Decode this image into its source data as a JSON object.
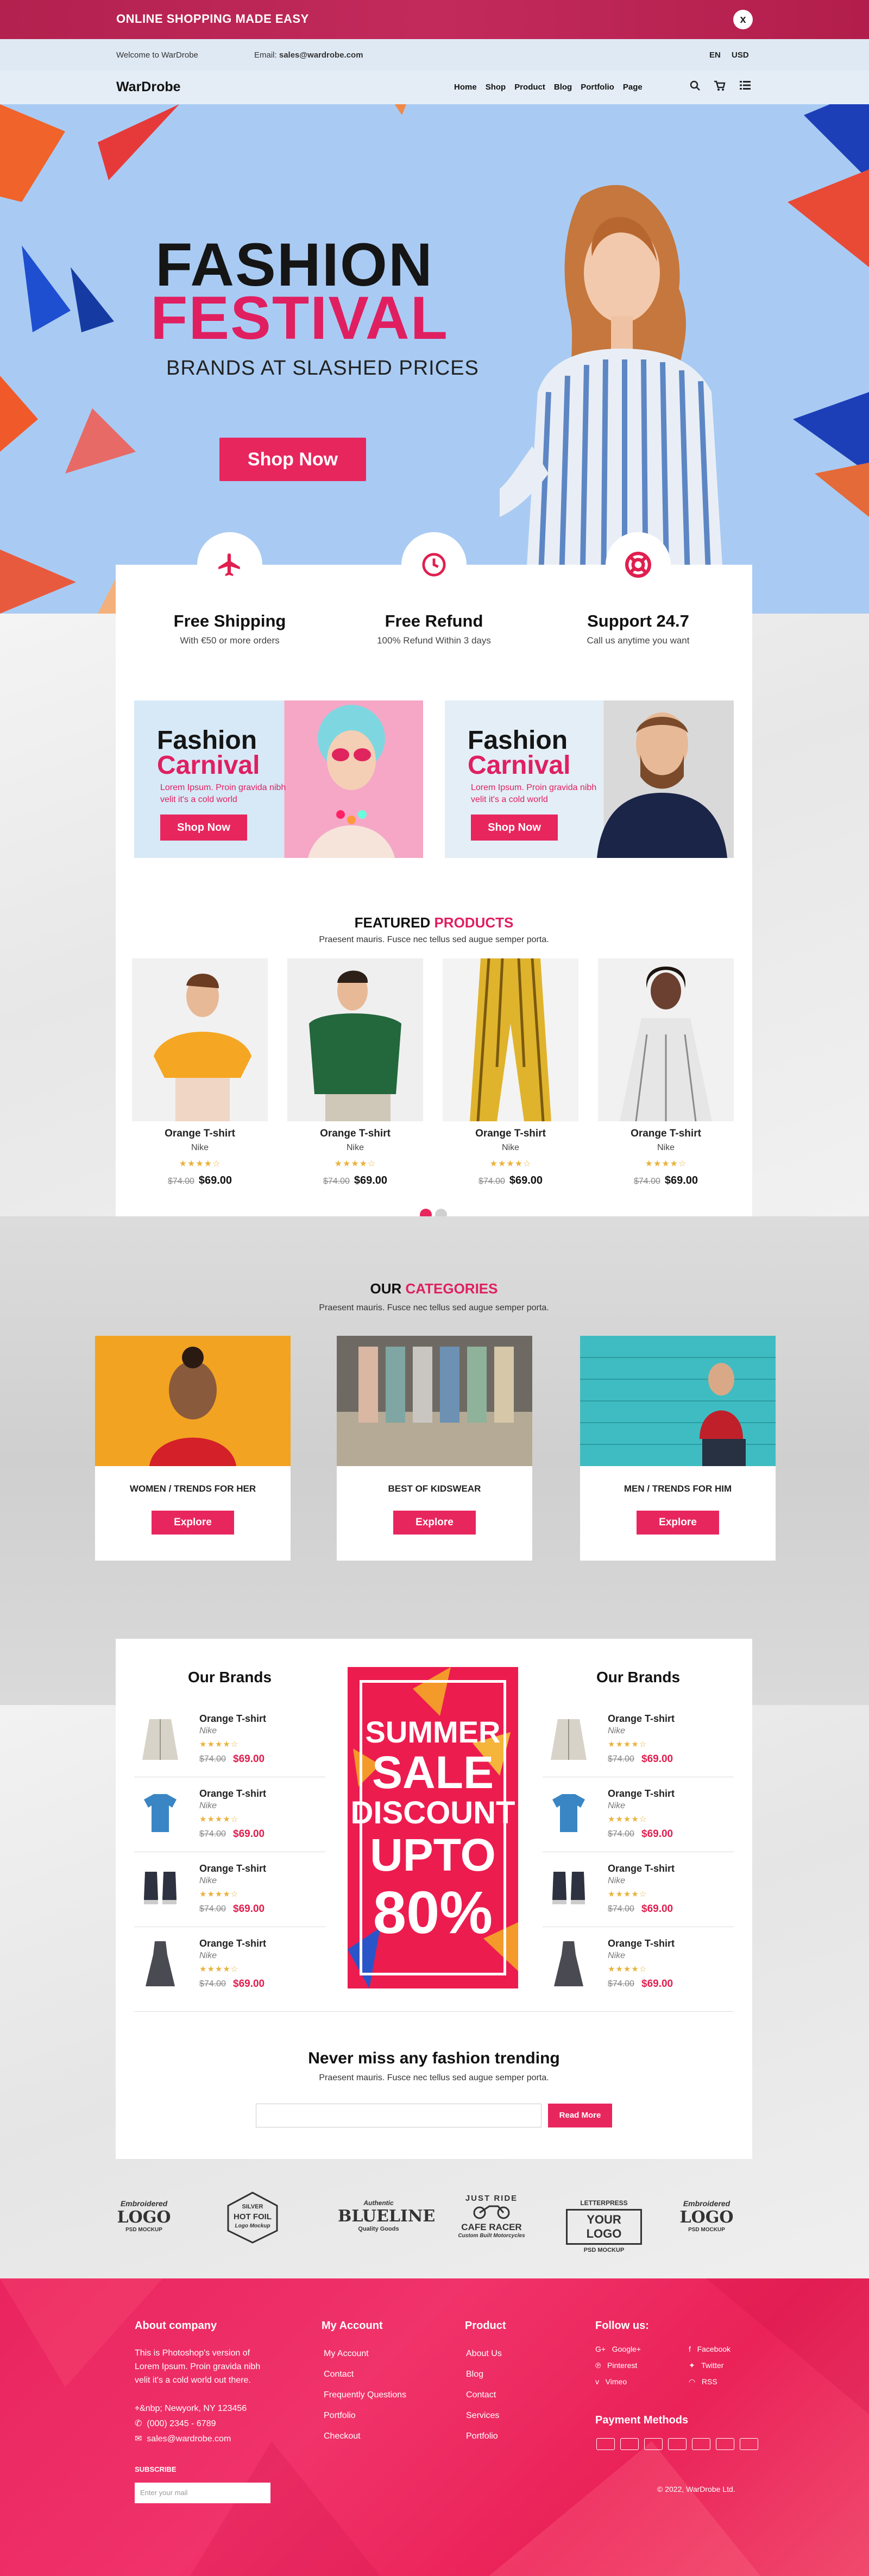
{
  "promo": {
    "text": "ONLINE SHOPPING MADE EASY",
    "close": "x"
  },
  "infobar": {
    "welcome": "Welcome to WarDrobe",
    "email_label": "Email:",
    "email": "sales@wardrobe.com",
    "lang": "EN",
    "currency": "USD"
  },
  "nav": {
    "logo": "WarDrobe",
    "links": [
      "Home",
      "Shop",
      "Product",
      "Blog",
      "Portfolio",
      "Page"
    ],
    "icons": [
      "search-icon",
      "cart-icon",
      "menu-icon"
    ]
  },
  "hero": {
    "title1": "FASHION",
    "title2": "FESTIVAL",
    "subtitle": "BRANDS AT SLASHED PRICES",
    "cta": "Shop Now"
  },
  "features": [
    {
      "icon": "plane-icon",
      "title": "Free Shipping",
      "sub": "With €50 or more orders"
    },
    {
      "icon": "clock-icon",
      "title": "Free Refund",
      "sub": "100% Refund Within 3 days"
    },
    {
      "icon": "lifebuoy-icon",
      "title": "Support 24.7",
      "sub": "Call us anytime you want"
    }
  ],
  "carnivals": [
    {
      "t1": "Fashion",
      "t2": "Carnival",
      "desc": "Lorem Ipsum. Proin gravida nibh velit it's a cold world",
      "cta": "Shop Now"
    },
    {
      "t1": "Fashion",
      "t2": "Carnival",
      "desc": "Lorem Ipsum. Proin gravida nibh velit it's a cold world",
      "cta": "Shop Now"
    }
  ],
  "featured": {
    "title_a": "FEATURED",
    "title_b": "PRODUCTS",
    "sub": "Praesent mauris. Fusce nec tellus sed augue semper porta.",
    "items": [
      {
        "name": "Orange T-shirt",
        "brand": "Nike",
        "stars": "★★★★☆",
        "old": "$74.00",
        "price": "$69.00"
      },
      {
        "name": "Orange T-shirt",
        "brand": "Nike",
        "stars": "★★★★☆",
        "old": "$74.00",
        "price": "$69.00"
      },
      {
        "name": "Orange T-shirt",
        "brand": "Nike",
        "stars": "★★★★☆",
        "old": "$74.00",
        "price": "$69.00"
      },
      {
        "name": "Orange T-shirt",
        "brand": "Nike",
        "stars": "★★★★☆",
        "old": "$74.00",
        "price": "$69.00"
      }
    ]
  },
  "categories": {
    "title_a": "OUR",
    "title_b": "CATEGORIES",
    "sub": "Praesent mauris. Fusce nec tellus sed augue semper porta.",
    "items": [
      {
        "name": "WOMEN / TRENDS FOR HER",
        "cta": "Explore"
      },
      {
        "name": "BEST OF KIDSWEAR",
        "cta": "Explore"
      },
      {
        "name": "MEN / TRENDS FOR HIM",
        "cta": "Explore"
      }
    ]
  },
  "brands": {
    "heading": "Our Brands",
    "items": [
      {
        "name": "Orange T-shirt",
        "brand": "Nike",
        "stars": "★★★★☆",
        "old": "$74.00",
        "price": "$69.00"
      },
      {
        "name": "Orange T-shirt",
        "brand": "Nike",
        "stars": "★★★★☆",
        "old": "$74.00",
        "price": "$69.00"
      },
      {
        "name": "Orange T-shirt",
        "brand": "Nike",
        "stars": "★★★★☆",
        "old": "$74.00",
        "price": "$69.00"
      },
      {
        "name": "Orange T-shirt",
        "brand": "Nike",
        "stars": "★★★★☆",
        "old": "$74.00",
        "price": "$69.00"
      }
    ]
  },
  "sale": {
    "l1": "SUMMER",
    "l2": "SALE",
    "l3": "DISCOUNT",
    "l4": "UPTO",
    "l5": "80%"
  },
  "newsletter": {
    "title": "Never miss any fashion trending",
    "sub": "Praesent mauris. Fusce nec tellus sed augue semper porta.",
    "cta": "Read More"
  },
  "logos": [
    {
      "a": "Embroidered",
      "b": "LOGO",
      "c": "PSD MOCKUP"
    },
    {
      "a": "SILVER",
      "b": "HOT FOIL",
      "c": "Logo Mockup"
    },
    {
      "a": "Authentic",
      "b": "BLUELINE",
      "c": "Quality Goods"
    },
    {
      "a": "JUST RIDE",
      "b": "CAFE RACER",
      "c": "Custom Built Motorcycles"
    },
    {
      "a": "LETTERPRESS",
      "b": "YOUR LOGO",
      "c": "PSD MOCKUP"
    },
    {
      "a": "Embroidered",
      "b": "LOGO",
      "c": "PSD MOCKUP"
    }
  ],
  "footer": {
    "about_h": "About company",
    "about_t": "This is Photoshop's version of Lorem Ipsum. Proin gravida nibh velit it's a cold world out there.",
    "address": "Newyork, NY 123456",
    "phone": "(000) 2345 - 6789",
    "email": "sales@wardrobe.com",
    "subscribe_h": "SUBSCRIBE",
    "subscribe_ph": "Enter your mail",
    "account_h": "My Account",
    "account": [
      "My Account",
      "Contact",
      "Frequently Questions",
      "Portfolio",
      "Checkout"
    ],
    "product_h": "Product",
    "product": [
      "About Us",
      "Blog",
      "Contact",
      "Services",
      "Portfolio"
    ],
    "follow_h": "Follow us:",
    "follow": [
      {
        "icon": "google-plus-icon",
        "g": "G+",
        "name": "Google+"
      },
      {
        "icon": "facebook-icon",
        "g": "f",
        "name": "Facebook"
      },
      {
        "icon": "pinterest-icon",
        "g": "℗",
        "name": "Pinterest"
      },
      {
        "icon": "twitter-icon",
        "g": "✦",
        "name": "Twitter"
      },
      {
        "icon": "vimeo-icon",
        "g": "v",
        "name": "Vimeo"
      },
      {
        "icon": "rss-icon",
        "g": "◠",
        "name": "RSS"
      }
    ],
    "payment_h": "Payment Methods",
    "copyright": "© 2022, WarDrobe Ltd."
  }
}
